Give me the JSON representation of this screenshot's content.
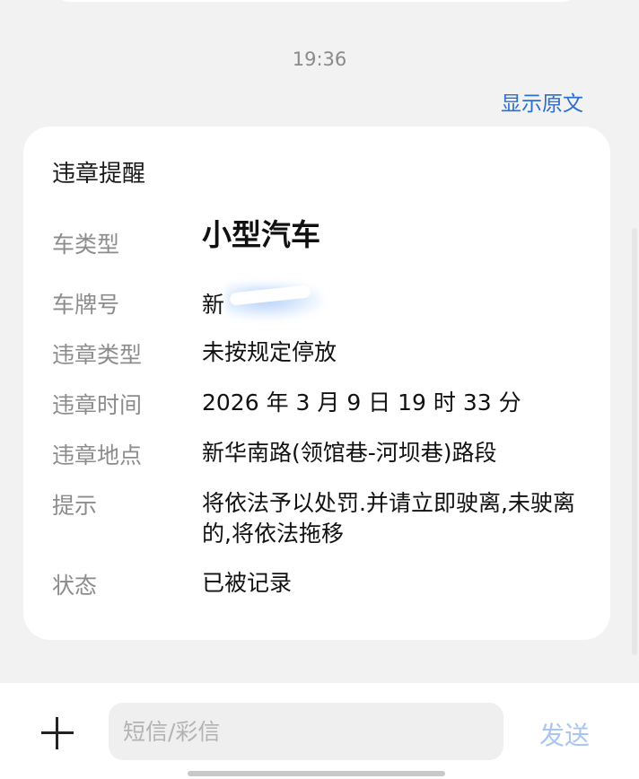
{
  "conversation": {
    "timestamp": "19:36",
    "show_original": "显示原文"
  },
  "card": {
    "title": "违章提醒",
    "rows": [
      {
        "label": "车类型",
        "value": "小型汽车"
      },
      {
        "label": "车牌号",
        "value": "新"
      },
      {
        "label": "违章类型",
        "value": "未按规定停放"
      },
      {
        "label": "违章时间",
        "value": "2026 年 3 月 9 日 19 时 33 分"
      },
      {
        "label": "违章地点",
        "value": "新华南路(领馆巷-河坝巷)路段"
      },
      {
        "label": "提示",
        "value": "将依法予以处罚.并请立即驶离,未驶离的,将依法拖移"
      },
      {
        "label": "状态",
        "value": "已被记录"
      }
    ]
  },
  "composer": {
    "input_placeholder": "短信/彩信",
    "input_value": "",
    "send_label": "发送",
    "plus_icon": "plus-icon"
  },
  "colors": {
    "accent": "#2a6fd1",
    "send_disabled": "#a8c6ef",
    "background": "#f2f2f2",
    "card": "#ffffff"
  }
}
